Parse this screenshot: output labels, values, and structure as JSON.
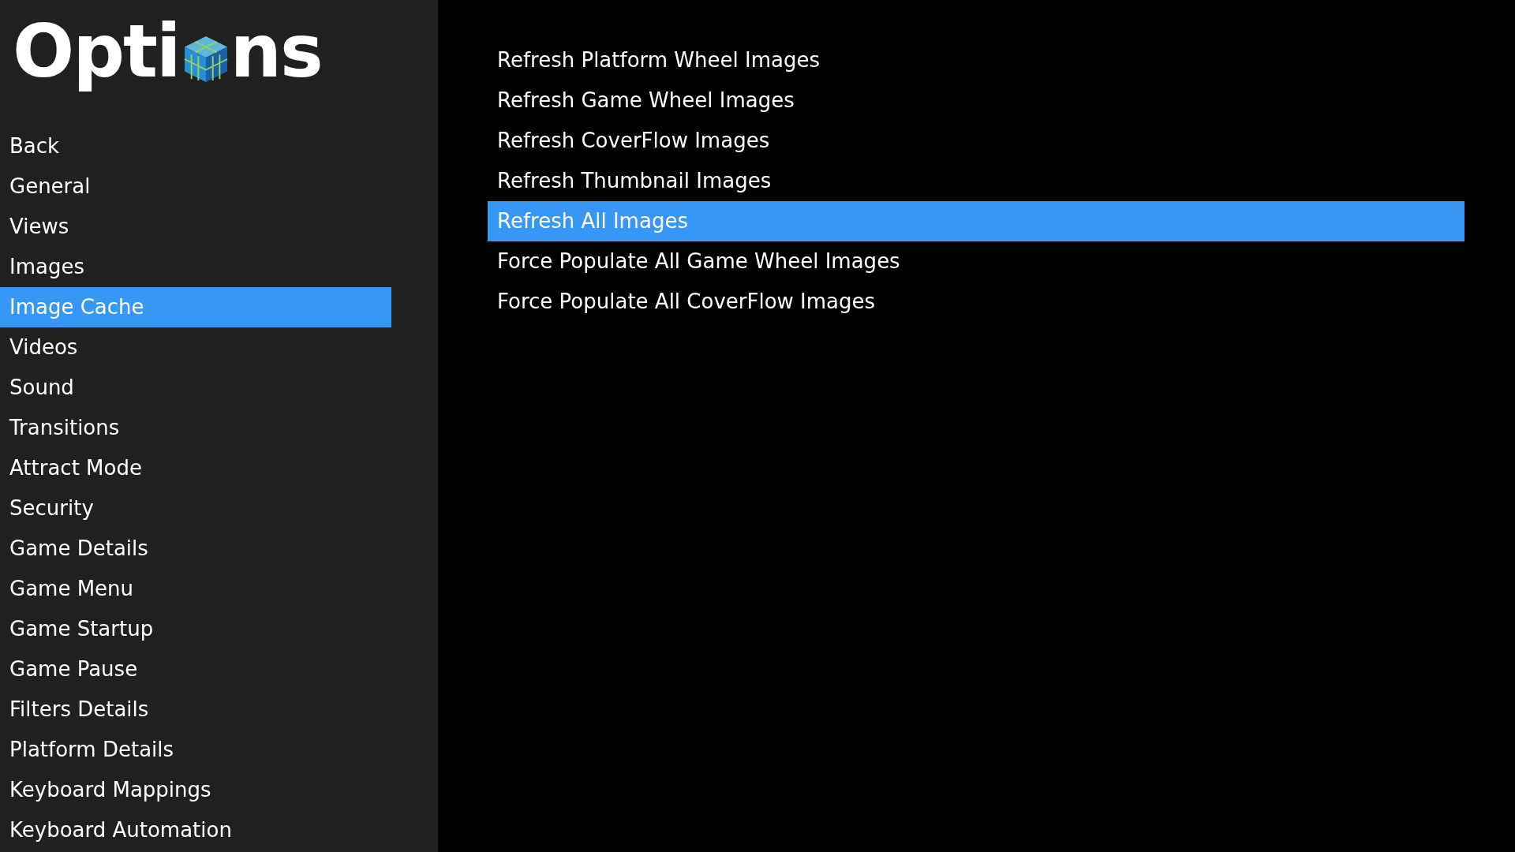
{
  "header": {
    "title_start": "Opti",
    "title_end": "ns"
  },
  "sidebar": {
    "items": [
      {
        "label": "Back",
        "selected": false
      },
      {
        "label": "General",
        "selected": false
      },
      {
        "label": "Views",
        "selected": false
      },
      {
        "label": "Images",
        "selected": false
      },
      {
        "label": "Image Cache",
        "selected": true
      },
      {
        "label": "Videos",
        "selected": false
      },
      {
        "label": "Sound",
        "selected": false
      },
      {
        "label": "Transitions",
        "selected": false
      },
      {
        "label": "Attract Mode",
        "selected": false
      },
      {
        "label": "Security",
        "selected": false
      },
      {
        "label": "Game Details",
        "selected": false
      },
      {
        "label": "Game Menu",
        "selected": false
      },
      {
        "label": "Game Startup",
        "selected": false
      },
      {
        "label": "Game Pause",
        "selected": false
      },
      {
        "label": "Filters Details",
        "selected": false
      },
      {
        "label": "Platform Details",
        "selected": false
      },
      {
        "label": "Keyboard Mappings",
        "selected": false
      },
      {
        "label": "Keyboard Automation",
        "selected": false
      }
    ]
  },
  "options": {
    "items": [
      {
        "label": "Refresh Platform Wheel Images",
        "selected": false
      },
      {
        "label": "Refresh Game Wheel Images",
        "selected": false
      },
      {
        "label": "Refresh CoverFlow Images",
        "selected": false
      },
      {
        "label": "Refresh Thumbnail Images",
        "selected": false
      },
      {
        "label": "Refresh All Images",
        "selected": true
      },
      {
        "label": "Force Populate All Game Wheel Images",
        "selected": false
      },
      {
        "label": "Force Populate All CoverFlow Images",
        "selected": false
      }
    ]
  }
}
